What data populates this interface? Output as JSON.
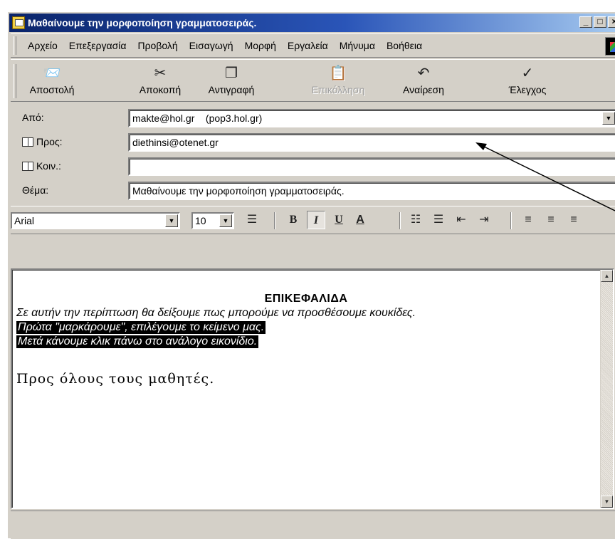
{
  "window": {
    "title": "Μαθαίνουμε την μορφοποίηση γραμματοσειράς."
  },
  "menu": [
    "Αρχείο",
    "Επεξεργασία",
    "Προβολή",
    "Εισαγωγή",
    "Μορφή",
    "Εργαλεία",
    "Μήνυμα",
    "Βοήθεια"
  ],
  "toolbar": {
    "send": "Αποστολή",
    "cut": "Αποκοπή",
    "copy": "Αντιγραφή",
    "paste": "Επικόλληση",
    "undo": "Αναίρεση",
    "check": "Έλεγχος"
  },
  "headers": {
    "from_label": "Από:",
    "from_value": "makte@hol.gr    (pop3.hol.gr)",
    "to_label": "Προς:",
    "to_value": "diethinsi@otenet.gr",
    "cc_label": "Κοιν.:",
    "cc_value": "",
    "subject_label": "Θέμα:",
    "subject_value": "Μαθαίνουμε την μορφοποίηση γραμματοσειράς."
  },
  "format": {
    "font": "Arial",
    "size": "10",
    "bold_pressed": false,
    "italic_pressed": true
  },
  "body": {
    "heading": "ΕΠΙΚΕΦΑΛΙΔΑ",
    "line1": "Σε αυτήν την περίπτωση θα δείξουμε πως μπορούμε να προσθέσουμε κουκίδες.",
    "selected1": "Πρώτα \"μαρκάρουμε\", επιλέγουμε το κείμενο μας.",
    "selected2": "Μετά κάνουμε κλικ πάνω στο ανάλογο εικονίδιο.",
    "closing": "Προς όλους τους μαθητές."
  },
  "colors": {
    "title_bar_start": "#0a246a",
    "title_bar_end": "#a6caf0",
    "face": "#d4d0c8",
    "selection": "#000000"
  }
}
